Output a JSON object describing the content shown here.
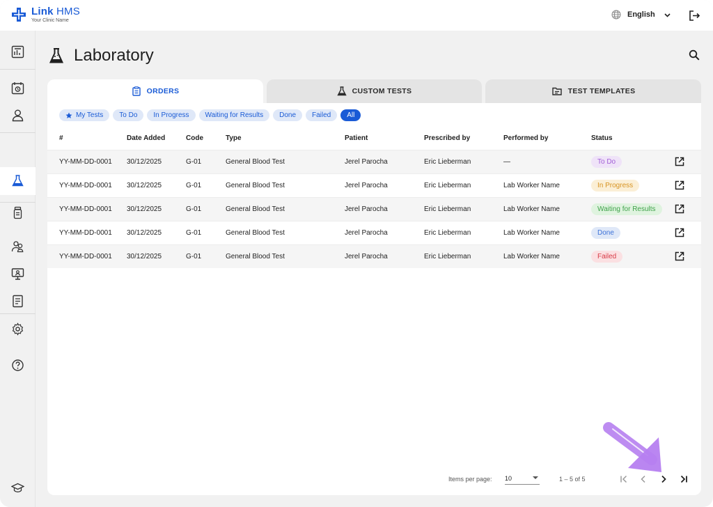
{
  "app": {
    "brand": "Link",
    "brand_suffix": "HMS",
    "clinic_name": "Your Clinic Name",
    "language": "English",
    "accent": "#1a5bd6"
  },
  "page": {
    "title": "Laboratory"
  },
  "tabs": [
    {
      "label": "ORDERS",
      "icon": "clipboard-icon",
      "active": true
    },
    {
      "label": "CUSTOM TESTS",
      "icon": "flask-icon",
      "active": false
    },
    {
      "label": "TEST TEMPLATES",
      "icon": "folder-icon",
      "active": false
    }
  ],
  "filters": [
    {
      "label": "My Tests",
      "icon": "star-icon",
      "active": false
    },
    {
      "label": "To Do",
      "active": false
    },
    {
      "label": "In Progress",
      "active": false
    },
    {
      "label": "Waiting for Results",
      "active": false
    },
    {
      "label": "Done",
      "active": false
    },
    {
      "label": "Failed",
      "active": false
    },
    {
      "label": "All",
      "active": true
    }
  ],
  "table": {
    "columns": [
      "#",
      "Date Added",
      "Code",
      "Type",
      "Patient",
      "Prescribed by",
      "Performed by",
      "Status"
    ],
    "rows": [
      {
        "id": "YY-MM-DD-0001",
        "date": "30/12/2025",
        "code": "G-01",
        "type": "General Blood Test",
        "patient": "Jerel Parocha",
        "prescribed_by": "Eric Lieberman",
        "performed_by": "—",
        "status": "To Do",
        "status_color": "#a25fd6"
      },
      {
        "id": "YY-MM-DD-0001",
        "date": "30/12/2025",
        "code": "G-01",
        "type": "General Blood Test",
        "patient": "Jerel Parocha",
        "prescribed_by": "Eric Lieberman",
        "performed_by": "Lab Worker Name",
        "status": "In Progress",
        "status_color": "#d79322"
      },
      {
        "id": "YY-MM-DD-0001",
        "date": "30/12/2025",
        "code": "G-01",
        "type": "General Blood Test",
        "patient": "Jerel Parocha",
        "prescribed_by": "Eric Lieberman",
        "performed_by": "Lab Worker Name",
        "status": "Waiting for Results",
        "status_color": "#3fa24a"
      },
      {
        "id": "YY-MM-DD-0001",
        "date": "30/12/2025",
        "code": "G-01",
        "type": "General Blood Test",
        "patient": "Jerel Parocha",
        "prescribed_by": "Eric Lieberman",
        "performed_by": "Lab Worker Name",
        "status": "Done",
        "status_color": "#3e73d8"
      },
      {
        "id": "YY-MM-DD-0001",
        "date": "30/12/2025",
        "code": "G-01",
        "type": "General Blood Test",
        "patient": "Jerel Parocha",
        "prescribed_by": "Eric Lieberman",
        "performed_by": "Lab Worker Name",
        "status": "Failed",
        "status_color": "#d83b47"
      }
    ]
  },
  "pagination": {
    "items_per_page_label": "Items per page:",
    "items_per_page": "10",
    "range": "1 – 5 of 5"
  },
  "sidebar_icons": [
    "dashboard-icon",
    "calendar-icon",
    "user-icon",
    "lab-flask-icon",
    "medicine-bottle-icon",
    "patients-group-icon",
    "monitor-icon",
    "report-icon",
    "settings-gear-icon",
    "help-icon",
    "graduation-cap-icon"
  ]
}
